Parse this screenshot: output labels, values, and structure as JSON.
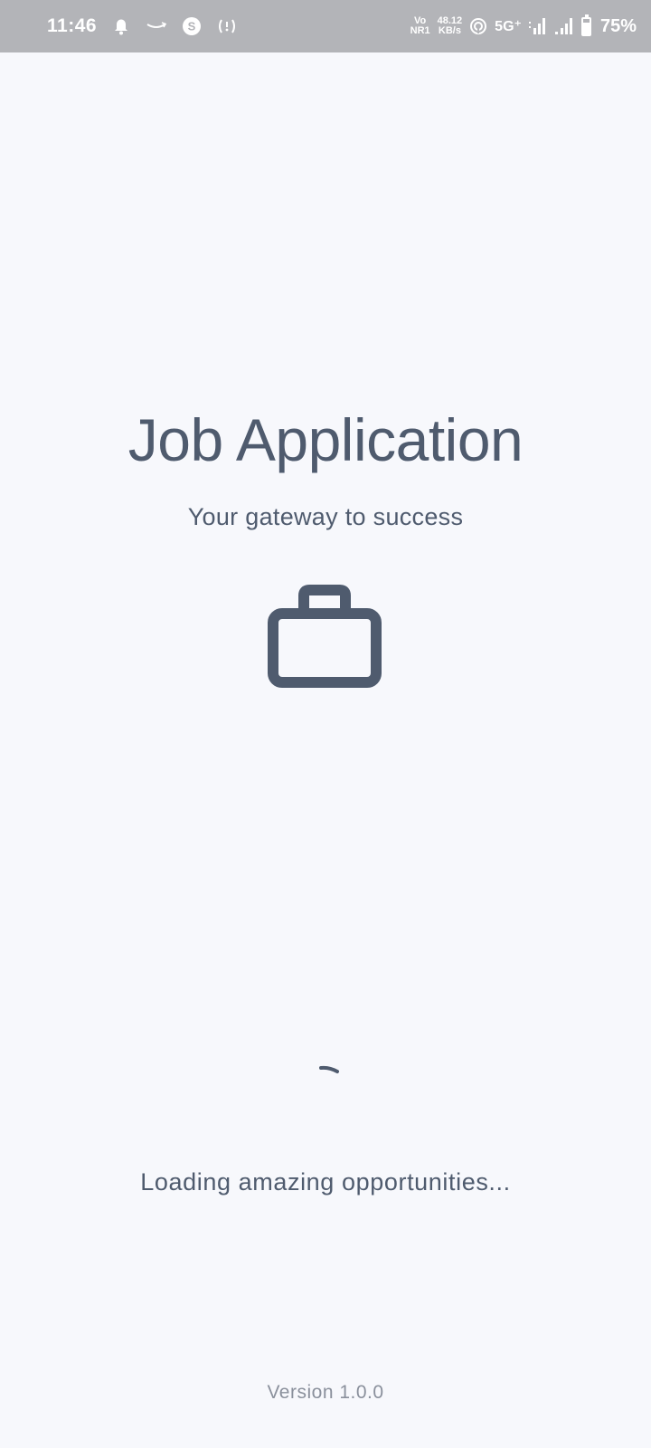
{
  "status_bar": {
    "time": "11:46",
    "volte_top": "Vo",
    "volte_bottom": "NR1",
    "speed_value": "48.12",
    "speed_unit": "KB/s",
    "network": "5G⁺",
    "battery_percent": "75%",
    "battery_level": 0.75,
    "icons": [
      "bell-muted-icon",
      "amazon-smile-icon",
      "s-circle-icon",
      "hotspot-icon",
      "wifi-calling-icon",
      "signal-bars-icon",
      "signal-bars-icon",
      "battery-icon"
    ]
  },
  "splash": {
    "title": "Job Application",
    "subtitle": "Your gateway to success",
    "icon": "briefcase-icon",
    "loading_text": "Loading amazing opportunities...",
    "version": "Version 1.0.0"
  },
  "colors": {
    "background": "#f7f8fc",
    "status_bar": "#b3b4b8",
    "primary_text": "#4f5b6e",
    "muted_text": "#8a909c"
  }
}
